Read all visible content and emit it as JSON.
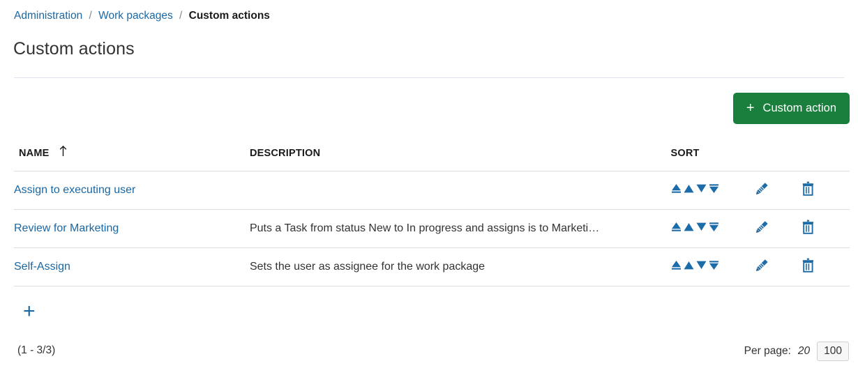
{
  "breadcrumb": {
    "items": [
      {
        "label": "Administration",
        "current": false
      },
      {
        "label": "Work packages",
        "current": false
      },
      {
        "label": "Custom actions",
        "current": true
      }
    ],
    "separator": "/"
  },
  "page": {
    "title": "Custom actions"
  },
  "toolbar": {
    "add_button_label": "Custom action",
    "add_button_icon": "plus-icon",
    "add_button_color": "#1a7f3c"
  },
  "table": {
    "headers": {
      "name": "NAME",
      "description": "DESCRIPTION",
      "sort": "SORT",
      "edit": "",
      "delete": ""
    },
    "sort_direction_icon": "arrow-up-icon",
    "sorted_by": "NAME",
    "sort_controls": [
      {
        "name": "move-to-top-icon",
        "title": "Move to top"
      },
      {
        "name": "move-up-icon",
        "title": "Move up"
      },
      {
        "name": "move-down-icon",
        "title": "Move down"
      },
      {
        "name": "move-to-bottom-icon",
        "title": "Move to bottom"
      }
    ],
    "rows": [
      {
        "name": "Assign to executing user",
        "description": "",
        "edit_icon": "pencil-icon",
        "delete_icon": "trash-icon"
      },
      {
        "name": "Review for Marketing",
        "description": "Puts a Task from status New to In progress and assigns is to Marketi…",
        "edit_icon": "pencil-icon",
        "delete_icon": "trash-icon"
      },
      {
        "name": "Self-Assign",
        "description": "Sets the user as assignee for the work package",
        "edit_icon": "pencil-icon",
        "delete_icon": "trash-icon"
      }
    ],
    "add_row_icon": "plus-icon"
  },
  "footer": {
    "range_label": "(1 - 3/3)",
    "per_page_label": "Per page:",
    "per_page_options": [
      {
        "value": "20",
        "selected": false
      },
      {
        "value": "100",
        "selected": true
      }
    ]
  },
  "colors": {
    "link": "#1a67a3",
    "accent_green": "#1a7f3c",
    "icon_blue": "#1a67a3",
    "border": "#dddddd"
  }
}
